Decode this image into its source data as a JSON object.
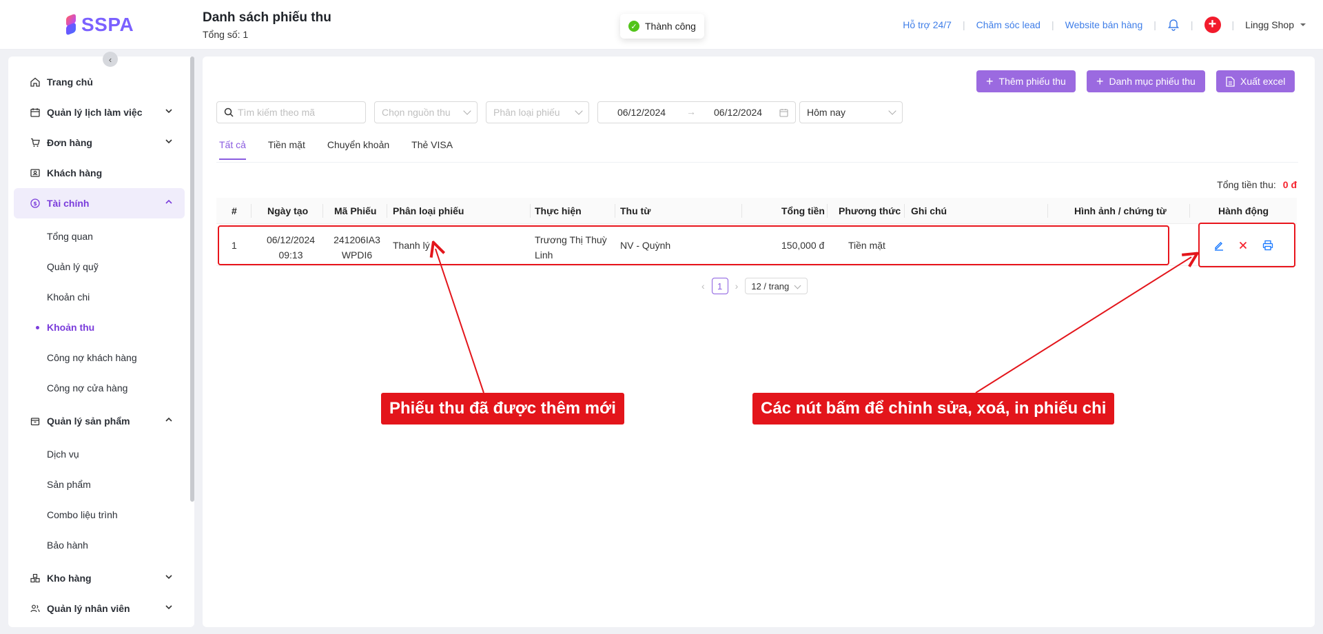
{
  "app": {
    "logo": "SSPA"
  },
  "header": {
    "title": "Danh sách phiếu thu",
    "subtitle": "Tổng số: 1",
    "toast": "Thành công",
    "links": [
      "Hỗ trợ 24/7",
      "Chăm sóc lead",
      "Website bán hàng"
    ],
    "shop": "Lingg Shop"
  },
  "sidebar": {
    "items": [
      {
        "label": "Trang chủ"
      },
      {
        "label": "Quản lý lịch làm việc"
      },
      {
        "label": "Đơn hàng"
      },
      {
        "label": "Khách hàng"
      },
      {
        "label": "Tài chính"
      }
    ],
    "finance_sub": [
      "Tổng quan",
      "Quản lý quỹ",
      "Khoản chi",
      "Khoản thu",
      "Công nợ khách hàng",
      "Công nợ cửa hàng"
    ],
    "product": "Quản lý sản phẩm",
    "product_sub": [
      "Dịch vụ",
      "Sản phẩm",
      "Combo liệu trình",
      "Bảo hành"
    ],
    "warehouse": "Kho hàng",
    "staff": "Quản lý nhân viên"
  },
  "toolbar": {
    "add": "Thêm phiếu thu",
    "category": "Danh mục phiếu thu",
    "export": "Xuất excel"
  },
  "filters": {
    "search_placeholder": "Tìm kiếm theo mã",
    "source_placeholder": "Chọn nguồn thu",
    "type_placeholder": "Phân loại phiếu",
    "date_from": "06/12/2024",
    "date_to": "06/12/2024",
    "range": "Hôm nay"
  },
  "tabs": [
    "Tất cả",
    "Tiền mặt",
    "Chuyển khoản",
    "Thẻ VISA"
  ],
  "summary": {
    "label": "Tổng tiền thu:",
    "value": "0 đ"
  },
  "table": {
    "headers": [
      "#",
      "Ngày tạo",
      "Mã Phiếu",
      "Phân loại phiếu",
      "Thực hiện",
      "Thu từ",
      "Tổng tiền",
      "Phương thức",
      "Ghi chú",
      "Hình ảnh / chứng từ",
      "Hành động"
    ],
    "rows": [
      {
        "index": "1",
        "date": "06/12/2024",
        "time": "09:13",
        "code1": "241206IA3",
        "code2": "WPDI6",
        "type": "Thanh lý",
        "performer1": "Trương Thị Thuỳ",
        "performer2": "Linh",
        "from": "NV - Quỳnh",
        "amount": "150,000 đ",
        "method": "Tiền mặt"
      }
    ]
  },
  "pagination": {
    "page": "1",
    "size": "12 / trang"
  },
  "callouts": {
    "left": "Phiếu thu đã được thêm mới",
    "right": "Các nút bấm để chỉnh sửa, xoá, in phiếu chi"
  },
  "colors": {
    "accent": "#8a5ce0",
    "button": "#9b6ae0",
    "danger": "#e3151b",
    "link": "#3f7ee8"
  }
}
